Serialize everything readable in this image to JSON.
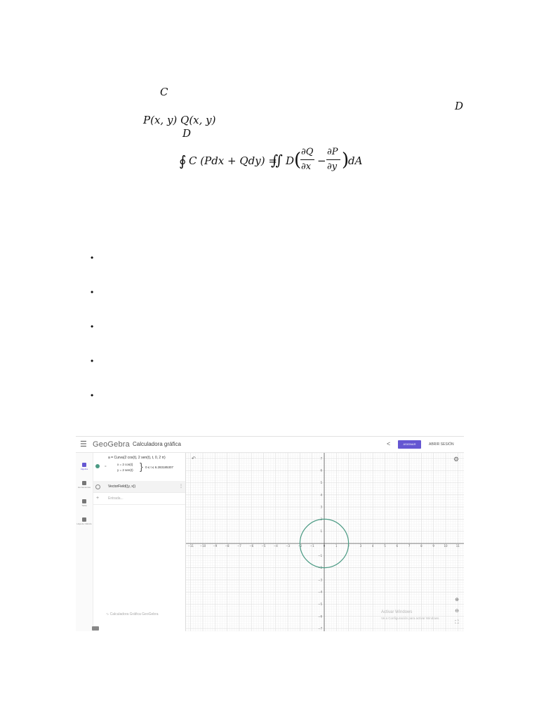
{
  "theorem_fragments": {
    "curve": "C",
    "region_right": "D",
    "functions": "P(x, y)    Q(x, y)",
    "region_below": "D",
    "formula": "∮ C (Pdx + Qdy) = ∬ D (∂Q/∂x − ∂P/∂y) dA"
  },
  "bullets": [
    "•",
    "•",
    "•",
    "•",
    "•"
  ],
  "geogebra": {
    "menu_icon": "menu-icon",
    "logo": "GeoGebra",
    "title": "Calculadora gráfica",
    "share_icon": "share-icon",
    "assign_label": "ASIGNAR",
    "login_label": "ABRIR SESIÓN",
    "accent_color": "#6557d2",
    "sidebar": [
      {
        "label": "Álgebra",
        "icon": "calculator-icon"
      },
      {
        "label": "Herramientas",
        "icon": "tools-icon"
      },
      {
        "label": "Tabla",
        "icon": "table-icon"
      },
      {
        "label": "Hoja de Cálculo",
        "icon": "book-icon"
      }
    ],
    "algebra": {
      "curve_def": "a = Curva(2 cos(t), 2 sen(t), t, 0, 2 π)",
      "curve_x": "x = 2 cos(t)",
      "curve_y": "y = 2 sen(t)",
      "curve_range": "0 ≤ t ≤ 6.283185307",
      "vector_field": "VectorField((y, x))",
      "input_placeholder": "Entrada...",
      "footer": "Calculadora Gráfica GeoGebra"
    },
    "graph": {
      "x_ticks": [
        "−11",
        "−10",
        "−9",
        "−8",
        "−7",
        "−6",
        "−5",
        "−4",
        "−3",
        "−2",
        "−1",
        "0",
        "1",
        "2",
        "3",
        "4",
        "5",
        "6",
        "7",
        "8",
        "9",
        "10",
        "11"
      ],
      "y_ticks": [
        "7",
        "6",
        "5",
        "4",
        "3",
        "2",
        "1",
        "−1",
        "−2",
        "−3",
        "−4",
        "−5",
        "−6",
        "−7"
      ],
      "circle_radius": 2,
      "circle_color": "#4a9a83",
      "watermark_title": "Activar Windows",
      "watermark_sub": "Ve a Configuración para activar Windows."
    }
  }
}
